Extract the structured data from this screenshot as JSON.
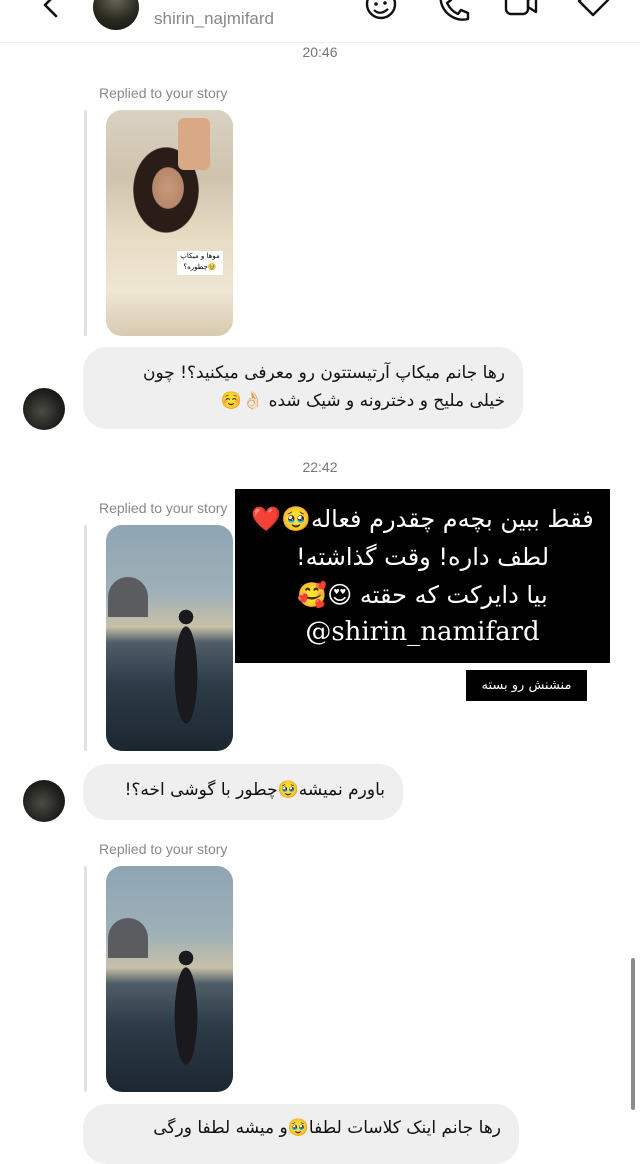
{
  "header": {
    "username": "shirin_najmifard"
  },
  "timestamps": [
    "20:46",
    "22:42"
  ],
  "replied_label": "Replied to your story",
  "story1_overlay": "موها و میکاپ چطوره؟🥹",
  "messages": [
    {
      "lines": [
        "رها جانم میکاپ آرتیستتون رو معرفی میکنید؟! چون",
        "خیلی ملیح و دخترونه و شیک شده 👌🏻☺️"
      ]
    },
    {
      "lines": [
        "باورم نمیشه🥹چطور با گوشی اخه؟!"
      ]
    },
    {
      "lines": [
        "رها جانم اینک کلاسات لطفا🥹و میشه لطفا ورگی"
      ]
    }
  ],
  "promo": {
    "line1": "فقط ببین بچه‌م چقدرم فعاله🥹❤️",
    "line2": "لطف داره! وقت گذاشته!",
    "line3": "بیا دایرکت که حقته 😍🥰",
    "handle": "@shirin_namifard"
  },
  "mention_tag": "منشنش رو بسته",
  "icons": {
    "back": "chevron-left-icon",
    "sticker": "sticker-icon",
    "call": "phone-icon",
    "video": "video-icon",
    "tag": "tag-icon"
  }
}
